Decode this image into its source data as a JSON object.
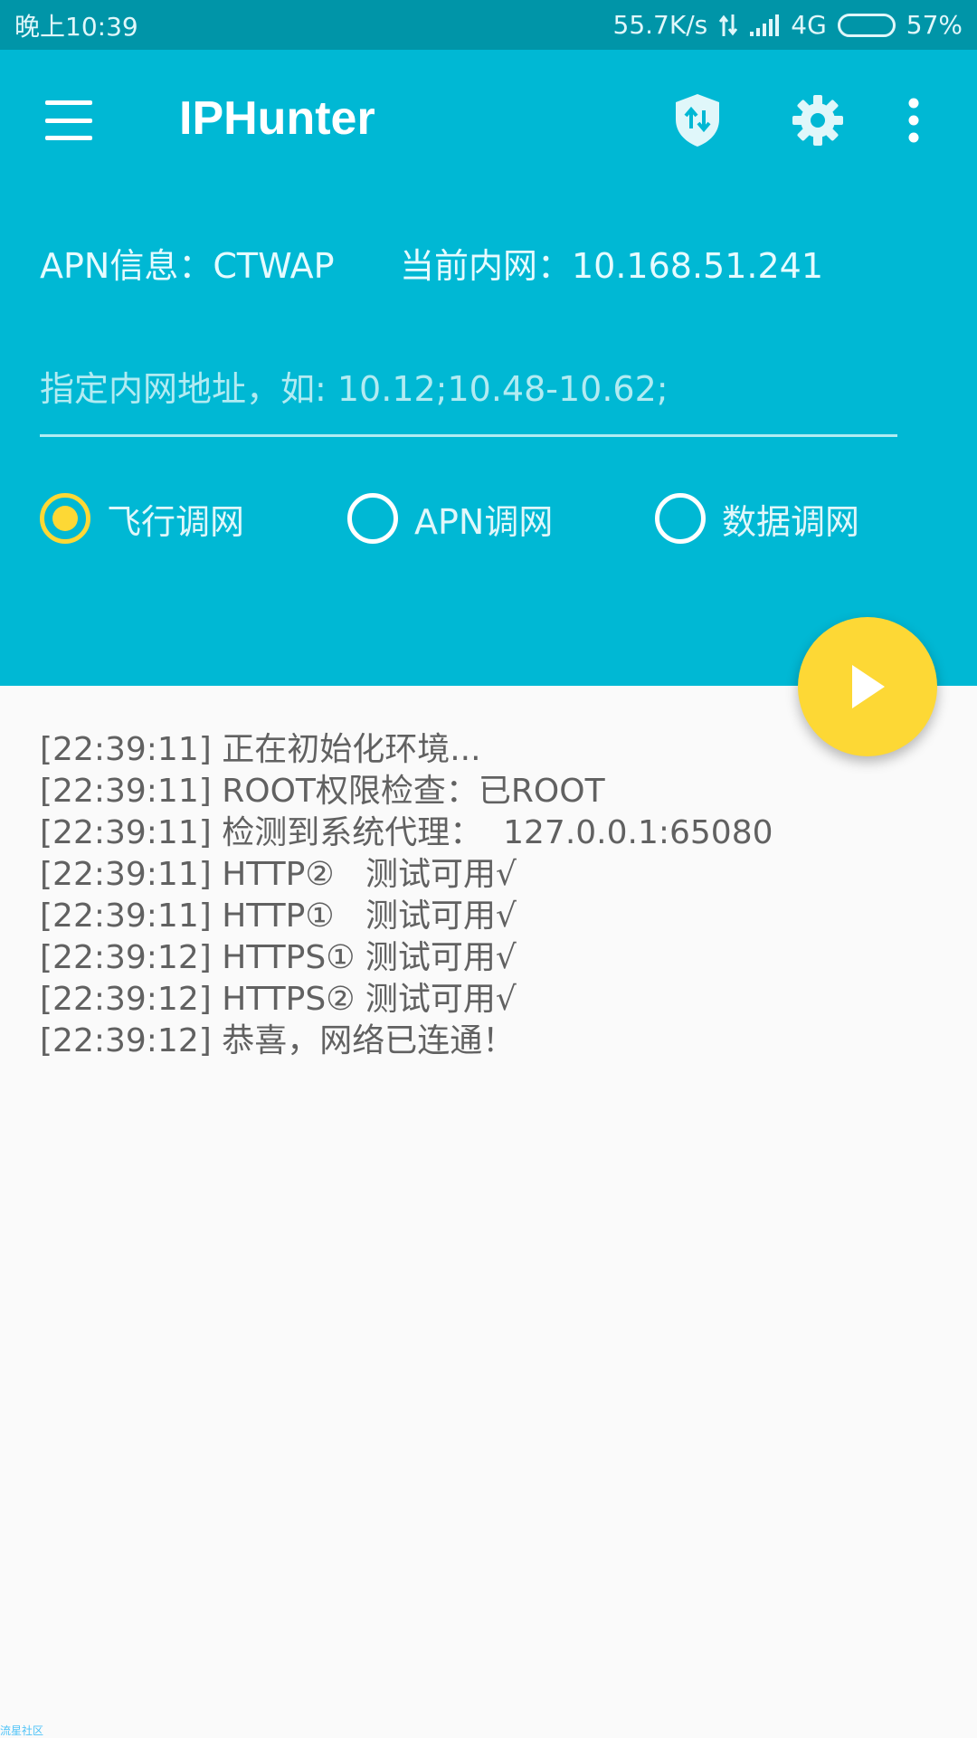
{
  "status_bar": {
    "time": "晚上10:39",
    "speed": "55.7K/s",
    "network": "4G",
    "battery": "57%",
    "battery_level": 0.57
  },
  "app_bar": {
    "title": "IPHunter",
    "icons": [
      "menu-icon",
      "shield-swap-icon",
      "gear-icon",
      "more-vert-icon"
    ]
  },
  "info": {
    "apn": "APN信息：CTWAP",
    "current_lan": "当前内网：10.168.51.241"
  },
  "input": {
    "value": "",
    "placeholder": "指定内网地址，如: 10.12;10.48-10.62;"
  },
  "modes": [
    {
      "label": "飞行调网",
      "selected": true
    },
    {
      "label": "APN调网",
      "selected": false
    },
    {
      "label": "数据调网",
      "selected": false
    }
  ],
  "log": [
    "[22:39:11] 正在初始化环境...",
    "[22:39:11] ROOT权限检查：已ROOT",
    "[22:39:11] 检测到系统代理：  127.0.0.1:65080",
    "[22:39:11] HTTP②   测试可用√",
    "[22:39:11] HTTP①   测试可用√",
    "[22:39:12] HTTPS① 测试可用√",
    "[22:39:12] HTTPS② 测试可用√",
    "[22:39:12] 恭喜，网络已连通！"
  ],
  "watermark": "流星社区",
  "colors": {
    "primary": "#00b8d4",
    "status_bar": "#0095a8",
    "accent": "#fdd835",
    "log_text": "#616161"
  }
}
